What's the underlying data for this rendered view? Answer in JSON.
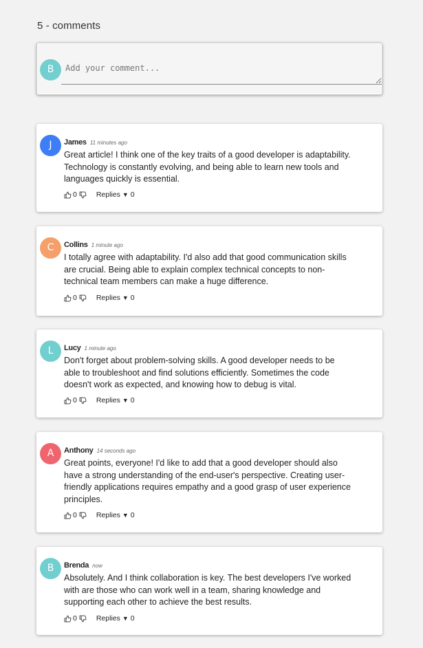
{
  "header": {
    "count_title": "5 - comments"
  },
  "composer": {
    "avatar_letter": "B",
    "avatar_color": "#72cfcf",
    "placeholder": "Add your comment..."
  },
  "comments": [
    {
      "author": "James",
      "time": "11 minutes ago",
      "avatar_letter": "J",
      "avatar_color": "#3d7df5",
      "text": "Great article! I think one of the key traits of a good developer is adaptability. Technology is constantly evolving, and being able to learn new tools and languages quickly is essential.",
      "likes": "0",
      "replies_label": "Replies",
      "replies_count": "0"
    },
    {
      "author": "Collins",
      "time": "1 minute ago",
      "avatar_letter": "C",
      "avatar_color": "#f59f6b",
      "text": "I totally agree with adaptability. I'd also add that good communication skills are crucial. Being able to explain complex technical concepts to non-technical team members can make a huge difference.",
      "likes": "0",
      "replies_label": "Replies",
      "replies_count": "0"
    },
    {
      "author": "Lucy",
      "time": "1 minute ago",
      "avatar_letter": "L",
      "avatar_color": "#72cfcf",
      "text": "Don't forget about problem-solving skills. A good developer needs to be able to troubleshoot and find solutions efficiently. Sometimes the code doesn't work as expected, and knowing how to debug is vital.",
      "likes": "0",
      "replies_label": "Replies",
      "replies_count": "0"
    },
    {
      "author": "Anthony",
      "time": "14 seconds ago",
      "avatar_letter": "A",
      "avatar_color": "#f0646e",
      "text": "Great points, everyone! I'd like to add that a good developer should also have a strong understanding of the end-user's perspective. Creating user-friendly applications requires empathy and a good grasp of user experience principles.",
      "likes": "0",
      "replies_label": "Replies",
      "replies_count": "0"
    },
    {
      "author": "Brenda",
      "time": "now",
      "avatar_letter": "B",
      "avatar_color": "#72cfcf",
      "text": "Absolutely. And I think collaboration is key. The best developers I've worked with are those who can work well in a team, sharing knowledge and supporting each other to achieve the best results.",
      "likes": "0",
      "replies_label": "Replies",
      "replies_count": "0"
    }
  ]
}
